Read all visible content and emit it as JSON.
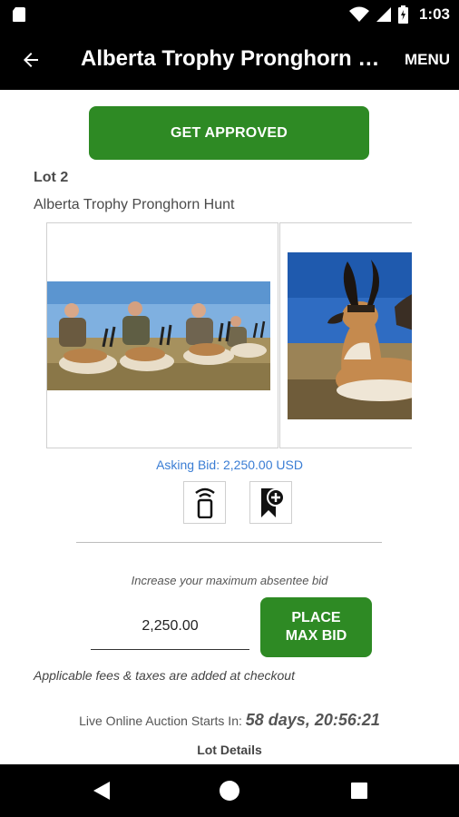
{
  "status_bar": {
    "time": "1:03",
    "icons": [
      "sd-card-icon",
      "wifi-icon",
      "signal-icon",
      "battery-icon"
    ]
  },
  "toolbar": {
    "title": "Alberta Trophy Pronghorn Hunt",
    "menu_label": "MENU",
    "back_icon": "arrow-left-icon"
  },
  "get_approved_label": "GET APPROVED",
  "lot": {
    "number_label": "Lot 2",
    "title": "Alberta Trophy Pronghorn Hunt"
  },
  "asking_bid": "Asking Bid: 2,250.00 USD",
  "actions": {
    "remote_icon": "remote-bid-icon",
    "watch_icon": "bookmark-add-icon"
  },
  "bid": {
    "increase_label": "Increase your maximum absentee bid",
    "value": "2,250.00",
    "place_label_line1": "PLACE",
    "place_label_line2": "MAX BID",
    "fees_note": "Applicable fees & taxes are added at checkout"
  },
  "auction": {
    "starts_label": "Live Online Auction Starts In: ",
    "countdown": "58 days, 20:56:21"
  },
  "lot_details_label": "Lot Details",
  "colors": {
    "accent_green": "#2e8a24",
    "link_blue": "#3a7dd4",
    "bar_black": "#000000"
  }
}
